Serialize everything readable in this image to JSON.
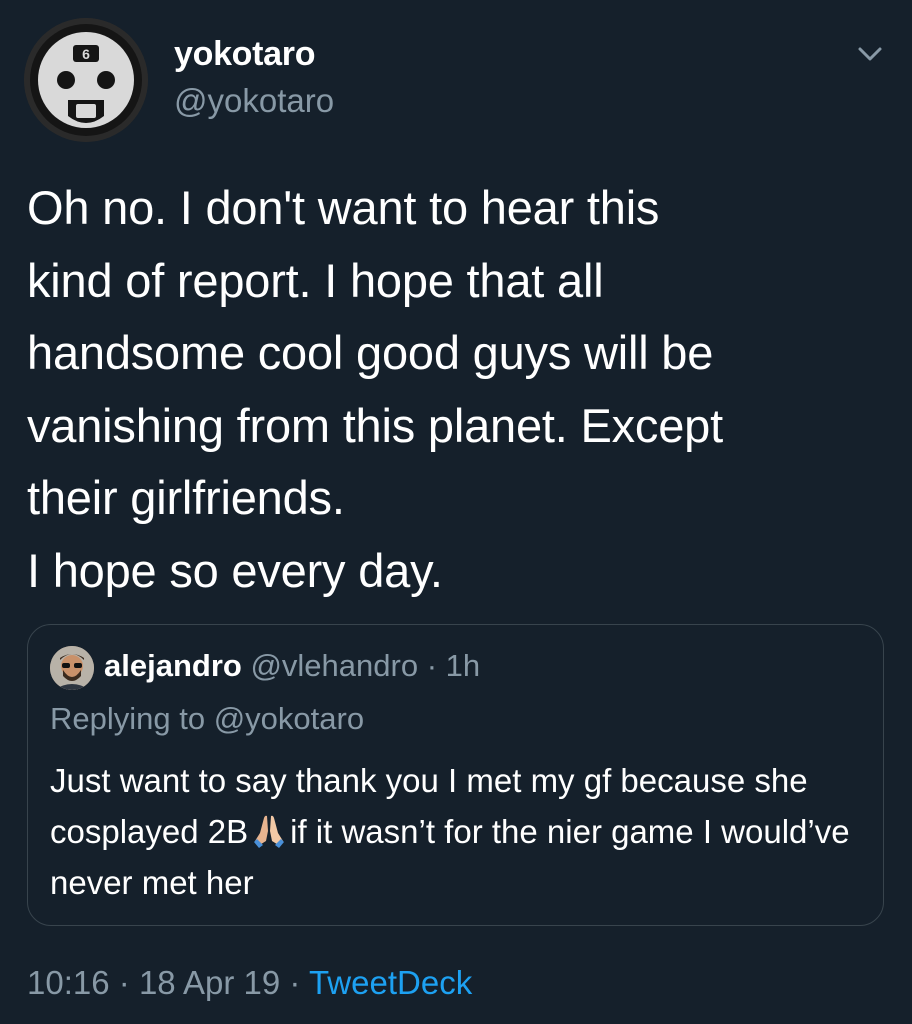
{
  "author": {
    "display_name": "yokotaro",
    "handle": "@yokotaro",
    "avatar_icon": "emil-mask-avatar-icon",
    "avatar_badge": "6"
  },
  "menu_icon": "chevron-down-icon",
  "tweet": {
    "text": "Oh no. I don't want to hear this\nkind of report. I hope that all\nhandsome cool good guys will be\nvanishing from this planet. Except\ntheir girlfriends.\nI hope so every day."
  },
  "quoted": {
    "display_name": "alejandro",
    "handle": "@vlehandro",
    "separator": "·",
    "time": "1h",
    "replying_to": "Replying to @yokotaro",
    "text_before_emoji": "Just want to say thank you I met my gf because she cosplayed 2B",
    "emoji_icon": "folded-hands-icon",
    "text_after_emoji": "if it wasn’t for the nier game I would’ve never met her"
  },
  "footer": {
    "time": "10:16",
    "sep1": "·",
    "date": "18 Apr 19",
    "sep2": "·",
    "source": "TweetDeck"
  },
  "colors": {
    "background": "#15202b",
    "text": "#ffffff",
    "secondary": "#8899a6",
    "link": "#1da1f2",
    "border": "#38444d"
  }
}
